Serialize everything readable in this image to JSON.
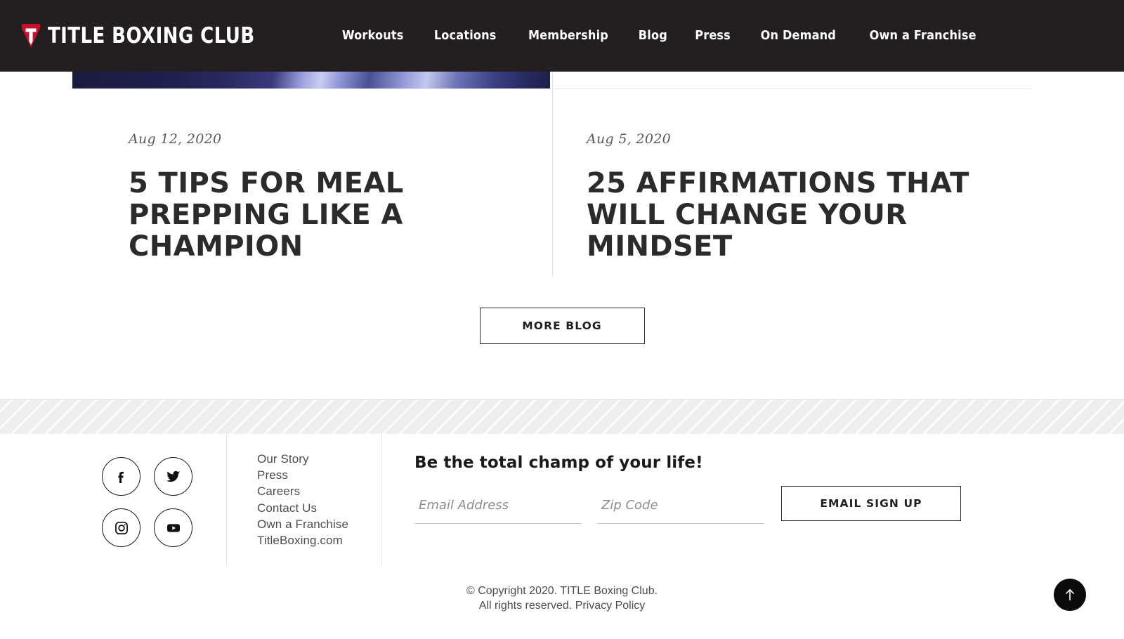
{
  "header": {
    "brand": {
      "logo_icon": "title-triangle-logo-icon",
      "text": "TITLE BOXING CLUB",
      "logo_color": "#c8102e",
      "background": "#231f20"
    },
    "nav": [
      {
        "label": "Workouts"
      },
      {
        "label": "Locations"
      },
      {
        "label": "Membership"
      },
      {
        "label": "Blog"
      },
      {
        "label": "Press"
      },
      {
        "label": "On Demand"
      },
      {
        "label": "Own a Franchise"
      }
    ]
  },
  "blog": {
    "posts": [
      {
        "date": "Aug 12, 2020",
        "title": "5 Tips for Meal Prepping Like a Champion",
        "thumbnail": "dark-blue-gradient-photo"
      },
      {
        "date": "Aug 5, 2020",
        "title": "25 Affirmations That Will Change Your Mindset",
        "thumbnail": "blank-photo"
      }
    ],
    "more_button": "MORE BLOG"
  },
  "footer": {
    "social": [
      {
        "name": "facebook-icon",
        "label": "Facebook"
      },
      {
        "name": "twitter-icon",
        "label": "Twitter"
      },
      {
        "name": "instagram-icon",
        "label": "Instagram"
      },
      {
        "name": "youtube-icon",
        "label": "YouTube"
      }
    ],
    "links": [
      {
        "label": "Our Story"
      },
      {
        "label": "Press"
      },
      {
        "label": "Careers"
      },
      {
        "label": "Contact Us"
      },
      {
        "label": "Own a Franchise"
      },
      {
        "label": "TitleBoxing.com"
      }
    ],
    "signup": {
      "title": "Be the total champ of your life!",
      "email_placeholder": "Email Address",
      "email_value": "",
      "zip_placeholder": "Zip Code",
      "zip_value": "",
      "button": "EMAIL SIGN UP"
    },
    "legal": {
      "line1": "© Copyright 2020. TITLE Boxing Club.",
      "line2_prefix": "All rights reserved.",
      "privacy_link": "Privacy Policy"
    },
    "back_to_top": {
      "icon": "arrow-up-icon",
      "label": "Back to top"
    }
  }
}
